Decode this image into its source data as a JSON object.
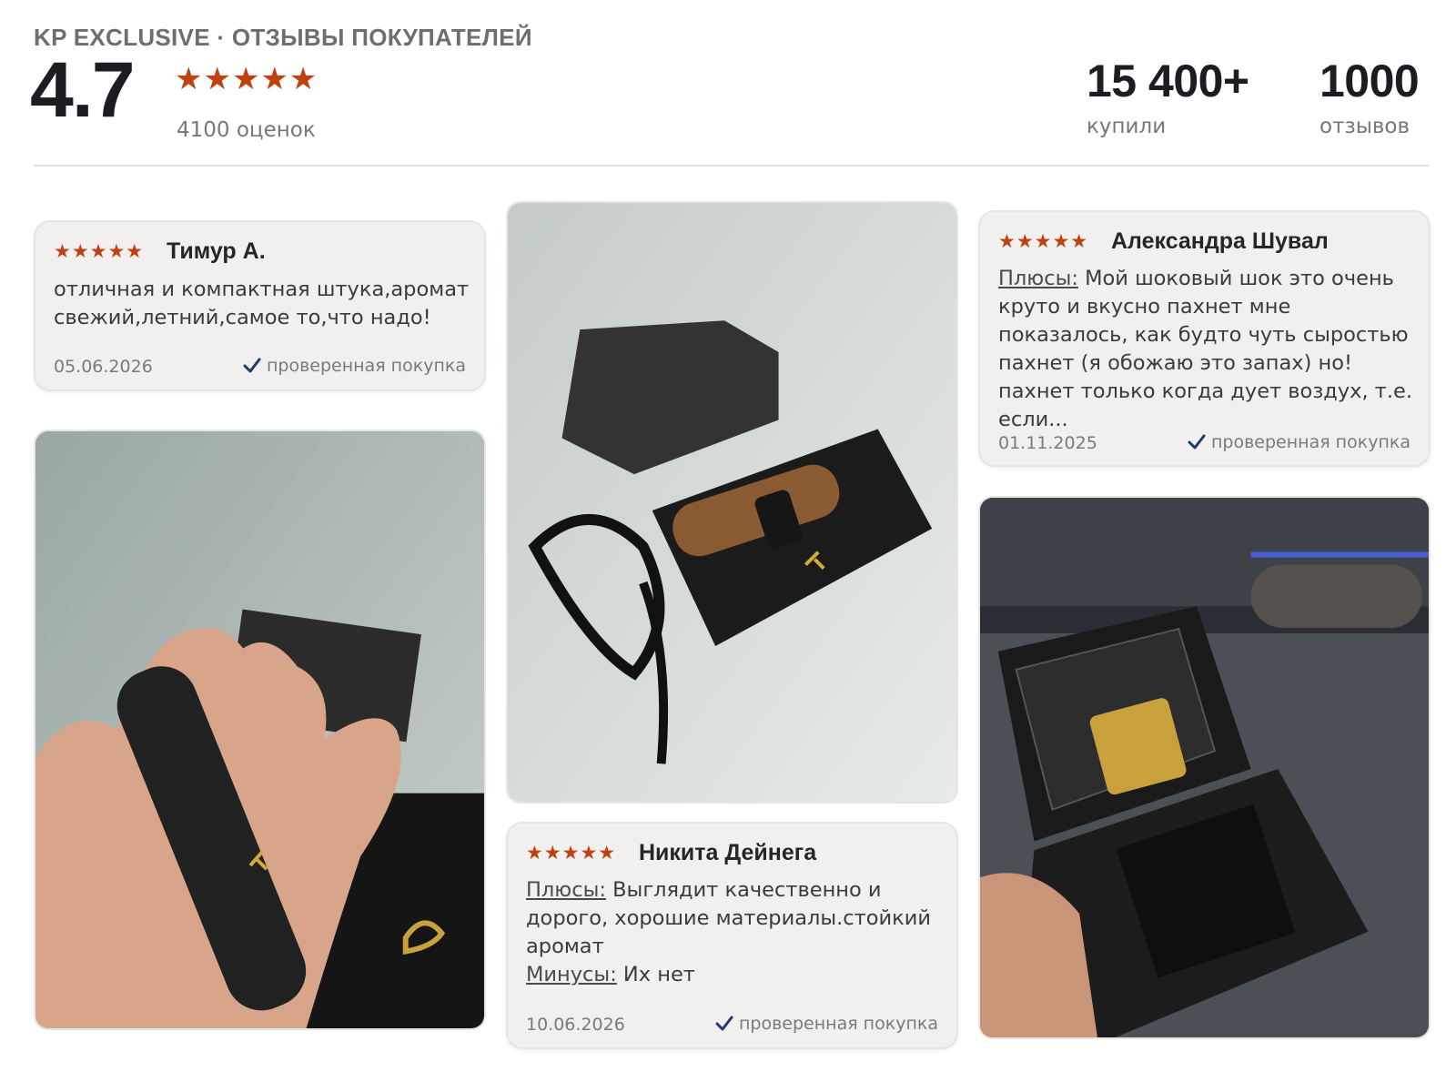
{
  "header": {
    "brand_line": "KP EXCLUSIVE · ОТЗЫВЫ ПОКУПАТЕЛЕЙ",
    "rating": "4.7",
    "stars": "★★★★★",
    "ratings_count": "4100 оценок",
    "stats": [
      {
        "value": "15 400+",
        "label": "купили"
      },
      {
        "value": "1000",
        "label": "отзывов"
      }
    ]
  },
  "accent_color": "#c0400f",
  "reviews": [
    {
      "stars": "★★★★★",
      "author": "Тимур А.",
      "text": "отличная и компактная штука,аромат свежий,летний,самое то,что надо!",
      "date": "05.06.2026",
      "verified": "проверенная покупка"
    },
    {
      "stars": "★★★★★",
      "author": "Никита Дейнега",
      "pros_label": "Плюсы:",
      "pros": " Выглядит качественно и дорого, хорошие материалы.стойкий аромат",
      "cons_label": "Минусы:",
      "cons": " Их нет",
      "date": "10.06.2026",
      "verified": "проверенная покупка"
    },
    {
      "stars": "★★★★★",
      "author": "Александра Шувал",
      "pros_label": "Плюсы:",
      "pros": " Мой шоковый шок    это очень круто и вкусно пахнет    мне показалось, как будто чуть сыростью пахнет (я обожаю это запах) но! пахнет только когда дует воздух, т.е. если...",
      "date": "01.11.2025",
      "verified": "проверенная покупка"
    }
  ],
  "photos": [
    {
      "icon": "product-photo-hand"
    },
    {
      "icon": "product-photo-box"
    },
    {
      "icon": "product-photo-case"
    }
  ]
}
